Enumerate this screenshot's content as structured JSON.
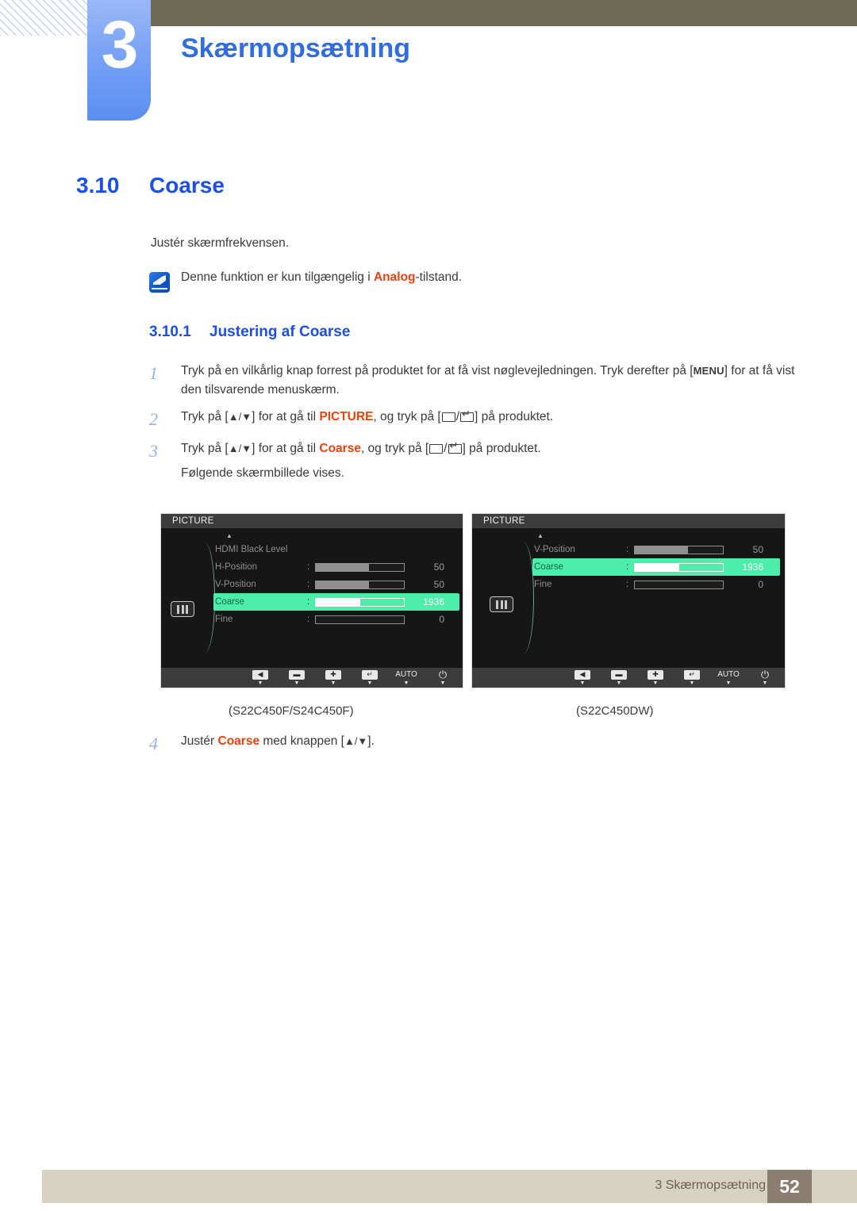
{
  "header": {
    "chapter_number": "3",
    "chapter_title": "Skærmopsætning"
  },
  "section": {
    "number": "3.10",
    "title": "Coarse",
    "intro": "Justér skærmfrekvensen."
  },
  "note": {
    "icon": "note-pen-icon",
    "text_before": "Denne funktion er kun tilgængelig i ",
    "highlight": "Analog",
    "text_after": "-tilstand."
  },
  "subsection": {
    "number": "3.10.1",
    "title": "Justering af Coarse"
  },
  "steps": [
    {
      "num": "1",
      "text_a": "Tryk på en vilkårlig knap forrest på produktet for at få vist nøglevejledningen. Tryk derefter på [",
      "key": "MENU",
      "text_b": "] for at få vist den tilsvarende menuskærm."
    },
    {
      "num": "2",
      "text_a": "Tryk på [",
      "arrows": "▲/▼",
      "text_b": "] for at gå til ",
      "highlight": "PICTURE",
      "text_c": ", og tryk på [",
      "text_d": "] på produktet."
    },
    {
      "num": "3",
      "text_a": "Tryk på [",
      "arrows": "▲/▼",
      "text_b": "] for at gå til ",
      "highlight": "Coarse",
      "text_c": ", og tryk på [",
      "text_d": "] på produktet.",
      "sub_line": "Følgende skærmbillede vises."
    },
    {
      "num": "4",
      "text_a": "Justér ",
      "highlight": "Coarse",
      "text_b": " med knappen [",
      "arrows": "▲/▼",
      "text_c": "]."
    }
  ],
  "osd_left": {
    "title": "PICTURE",
    "caption": "(S22C450F/S24C450F)",
    "up_arrow": "▲",
    "menu_icon": "picture-bars-icon",
    "rows": [
      {
        "label": "HDMI Black Level",
        "has_slider": false,
        "value": "",
        "fill_pct": 0,
        "selected": false
      },
      {
        "label": "H-Position",
        "has_slider": true,
        "value": "50",
        "fill_pct": 60,
        "selected": false
      },
      {
        "label": "V-Position",
        "has_slider": true,
        "value": "50",
        "fill_pct": 60,
        "selected": false
      },
      {
        "label": "Coarse",
        "has_slider": true,
        "value": "1936",
        "fill_pct": 50,
        "selected": true
      },
      {
        "label": "Fine",
        "has_slider": true,
        "value": "0",
        "fill_pct": 0,
        "selected": false
      }
    ],
    "buttons": [
      {
        "name": "left-arrow-button",
        "glyph": "◀"
      },
      {
        "name": "minus-button",
        "glyph": "▬"
      },
      {
        "name": "plus-button",
        "glyph": "✚"
      },
      {
        "name": "enter-button",
        "glyph": "↵"
      },
      {
        "name": "auto-button",
        "glyph": "AUTO"
      },
      {
        "name": "power-button",
        "glyph": "⏻"
      }
    ]
  },
  "osd_right": {
    "title": "PICTURE",
    "caption": "(S22C450DW)",
    "up_arrow": "▲",
    "menu_icon": "picture-bars-icon",
    "rows": [
      {
        "label": "V-Position",
        "has_slider": true,
        "value": "50",
        "fill_pct": 60,
        "selected": false
      },
      {
        "label": "Coarse",
        "has_slider": true,
        "value": "1936",
        "fill_pct": 50,
        "selected": true
      },
      {
        "label": "Fine",
        "has_slider": true,
        "value": "0",
        "fill_pct": 0,
        "selected": false
      }
    ],
    "buttons": [
      {
        "name": "left-arrow-button",
        "glyph": "◀"
      },
      {
        "name": "minus-button",
        "glyph": "▬"
      },
      {
        "name": "plus-button",
        "glyph": "✚"
      },
      {
        "name": "enter-button",
        "glyph": "↵"
      },
      {
        "name": "auto-button",
        "glyph": "AUTO"
      },
      {
        "name": "power-button",
        "glyph": "⏻"
      }
    ]
  },
  "footer": {
    "text": "3 Skærmopsætning",
    "page": "52"
  },
  "colors": {
    "heading_blue": "#1b4fe6",
    "chapter_blue": "#2f6de0",
    "tab_blue": "#5b8ef2",
    "olive": "#6e6a56",
    "orange": "#e8420f",
    "step_num": "#9aafe8",
    "osd_green": "#4dedab",
    "footer_beige": "#d8d2c0",
    "footer_taupe": "#8a7e70"
  }
}
